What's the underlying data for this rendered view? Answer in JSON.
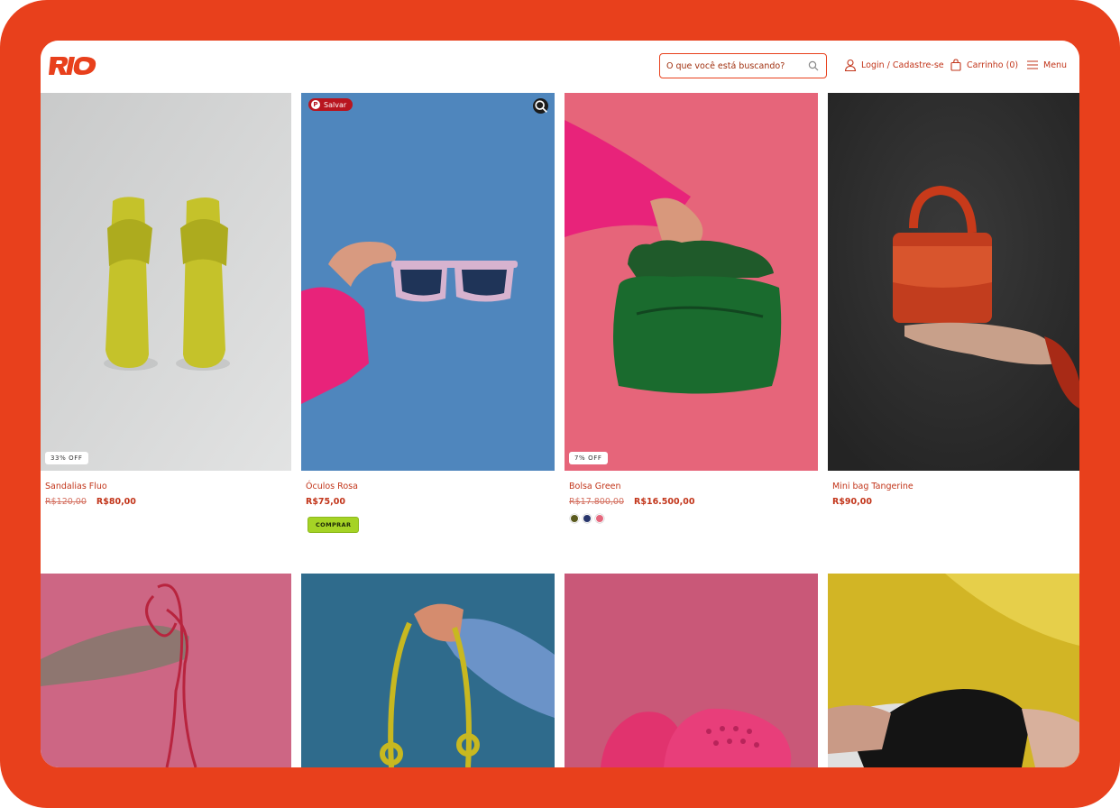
{
  "brand": {
    "logo_text": "RIO",
    "accent": "#e8401c"
  },
  "header": {
    "search_placeholder": "O que você está buscando?",
    "login_label": "Login / Cadastre-se",
    "cart_label": "Carrinho (0)",
    "menu_label": "Menu"
  },
  "pin_overlay": {
    "save_label": "Salvar"
  },
  "products": [
    {
      "name": "Sandalias Fluo",
      "old_price": "R$120,00",
      "price": "R$80,00",
      "badge": "33% OFF",
      "image": "yellow-sandals-on-grey"
    },
    {
      "name": "Óculos Rosa",
      "price": "R$75,00",
      "button": "COMPRAR",
      "image": "pink-sunglasses-on-blue"
    },
    {
      "name": "Bolsa Green",
      "old_price": "R$17.800,00",
      "price": "R$16.500,00",
      "badge": "7% OFF",
      "swatches": [
        "#5a5a1e",
        "#27356b",
        "#e5677c"
      ],
      "image": "green-bag-on-pink"
    },
    {
      "name": "Mini bag Tangerine",
      "price": "R$90,00",
      "image": "orange-mini-bag-on-dark"
    },
    {
      "image": "pink-cord-on-pink"
    },
    {
      "image": "yellow-rope-bag-on-teal"
    },
    {
      "image": "pink-clogs-on-pink"
    },
    {
      "image": "black-item-on-yellow"
    }
  ]
}
